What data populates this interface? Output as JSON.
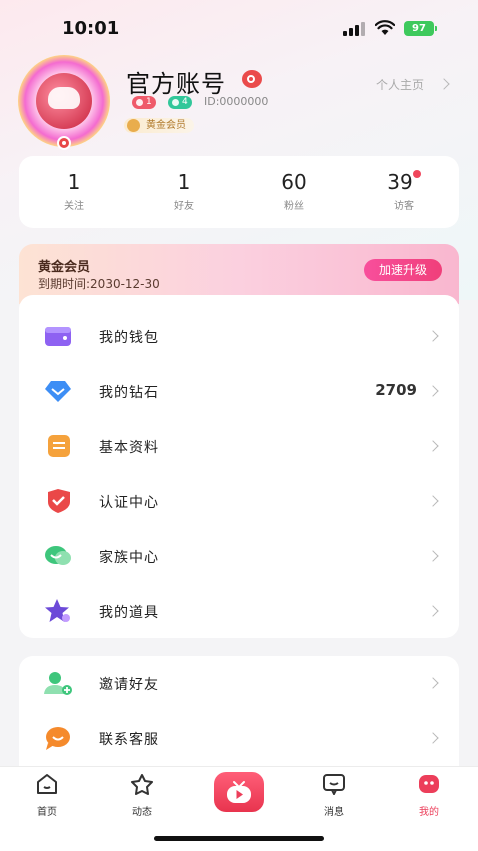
{
  "status_bar": {
    "time": "10:01",
    "battery": "97"
  },
  "profile": {
    "nickname": "官方账号",
    "badge_red": "1",
    "badge_green": "4",
    "uid": "ID:0000000",
    "vip_tag": "黄金会员",
    "home_link": "个人主页"
  },
  "stats": [
    {
      "num": "1",
      "label": "关注"
    },
    {
      "num": "1",
      "label": "好友"
    },
    {
      "num": "60",
      "label": "粉丝"
    },
    {
      "num": "39",
      "label": "访客"
    }
  ],
  "vip": {
    "title": "黄金会员",
    "expire": "到期时间:2030-12-30",
    "upgrade_btn": "加速升级"
  },
  "menu": [
    {
      "label": "我的钱包",
      "icon": "wallet-icon",
      "value": ""
    },
    {
      "label": "我的钻石",
      "icon": "diamond-icon",
      "value": "2709"
    },
    {
      "label": "基本资料",
      "icon": "profile-info-icon",
      "value": ""
    },
    {
      "label": "认证中心",
      "icon": "verify-shield-icon",
      "value": ""
    },
    {
      "label": "家族中心",
      "icon": "family-icon",
      "value": ""
    },
    {
      "label": "我的道具",
      "icon": "props-star-icon",
      "value": ""
    }
  ],
  "menu2": [
    {
      "label": "邀请好友",
      "icon": "invite-friend-icon"
    },
    {
      "label": "联系客服",
      "icon": "customer-service-icon"
    }
  ],
  "tabs": [
    {
      "label": "首页",
      "icon": "home-icon"
    },
    {
      "label": "动态",
      "icon": "moments-icon"
    },
    {
      "label": "",
      "icon": "live-tv-icon"
    },
    {
      "label": "消息",
      "icon": "message-icon"
    },
    {
      "label": "我的",
      "icon": "me-icon"
    }
  ],
  "colors": {
    "accent": "#ec3e5a",
    "vip_btn": "#f84f9c",
    "chevron": "#b8b8b8"
  }
}
